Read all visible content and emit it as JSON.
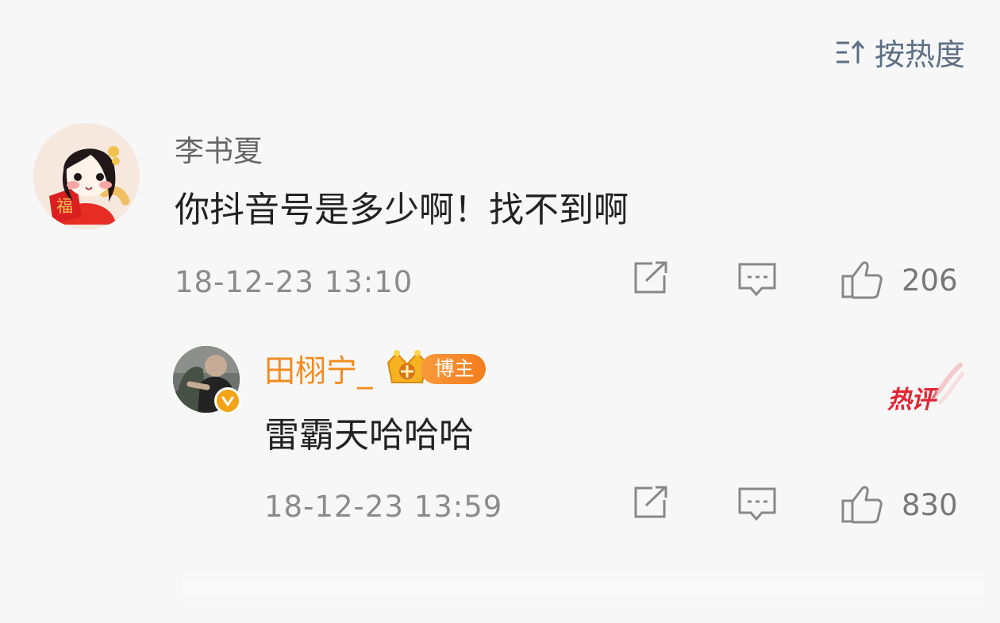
{
  "sort": {
    "label": "按热度"
  },
  "comment": {
    "author": "李书夏",
    "text": "你抖音号是多少啊！找不到啊",
    "time": "18-12-23 13:10",
    "likes": "206"
  },
  "reply": {
    "author": "田栩宁_",
    "badge": "博主",
    "text": "雷霸天哈哈哈",
    "time": "18-12-23 13:59",
    "likes": "830",
    "hot_tag": "热评"
  },
  "colors": {
    "sort_text": "#5d6f85",
    "meta_text": "#8b8b8b",
    "author_highlight": "#f38b1e",
    "hot_tag": "#e22635"
  }
}
